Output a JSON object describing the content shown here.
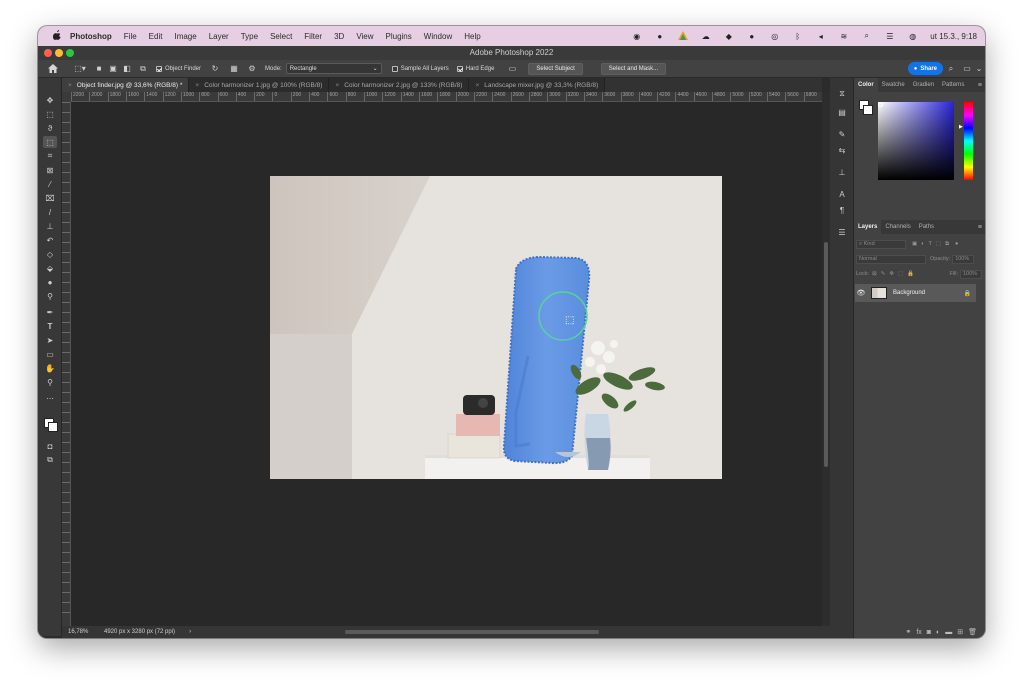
{
  "menubar": {
    "apple": "",
    "items": [
      "Photoshop",
      "File",
      "Edit",
      "Image",
      "Layer",
      "Type",
      "Select",
      "Filter",
      "3D",
      "View",
      "Plugins",
      "Window",
      "Help"
    ],
    "clock": "ut 15.3.,  9:18",
    "status_icons": [
      "cursor-icon",
      "record-icon",
      "color-wheel-icon",
      "creative-cloud-icon",
      "dropbox-icon",
      "media-icon",
      "timer-icon",
      "bluetooth-icon",
      "volume-icon",
      "wifi-icon",
      "search-icon",
      "control-center-icon",
      "siri-icon"
    ]
  },
  "window": {
    "title": "Adobe Photoshop 2022"
  },
  "options": {
    "object_finder": "Object Finder",
    "mode_label": "Mode:",
    "mode_value": "Rectangle",
    "sample_all_layers": "Sample All Layers",
    "hard_edge": "Hard Edge",
    "select_subject": "Select Subject",
    "select_and_mask": "Select and Mask...",
    "share": "Share"
  },
  "tabs": [
    {
      "label": "Object finder.jpg @ 33,6% (RGB/8) *",
      "active": true
    },
    {
      "label": "Color harmonizer 1.jpg @ 100% (RGB/8)",
      "active": false
    },
    {
      "label": "Color harmonizer 2.jpg @ 133% (RGB/8)",
      "active": false
    },
    {
      "label": "Landscape mixer.jpg @ 33,3% (RGB/8)",
      "active": false
    }
  ],
  "ruler_labels": [
    "2200",
    "2000",
    "1800",
    "1600",
    "1400",
    "1200",
    "1000",
    "800",
    "600",
    "400",
    "200",
    "0",
    "200",
    "400",
    "600",
    "800",
    "1000",
    "1200",
    "1400",
    "1600",
    "1800",
    "2000",
    "2200",
    "2400",
    "2600",
    "2800",
    "3000",
    "3200",
    "3400",
    "3600",
    "3800",
    "4000",
    "4200",
    "4400",
    "4600",
    "4800",
    "5000",
    "5200",
    "5400",
    "5600",
    "5800"
  ],
  "status": {
    "zoom": "16,78%",
    "doc_info": "4920 px x 3280 px (72 ppi)",
    "arrow": "›"
  },
  "color_panel": {
    "tabs": [
      "Color",
      "Swatche",
      "Gradien",
      "Patterns"
    ],
    "foreground": "#ffffff",
    "background": "#ffffff",
    "hue_field": "#2a24d8"
  },
  "layers_panel": {
    "tabs": [
      "Layers",
      "Channels",
      "Paths"
    ],
    "kind": "Kind",
    "blend_mode": "Normal",
    "opacity_label": "Opacity:",
    "opacity_value": "100%",
    "lock_label": "Lock:",
    "fill_label": "Fill:",
    "fill_value": "100%",
    "layers": [
      {
        "name": "Background",
        "visible": true,
        "locked": true
      }
    ]
  },
  "accent": "#1473e6"
}
